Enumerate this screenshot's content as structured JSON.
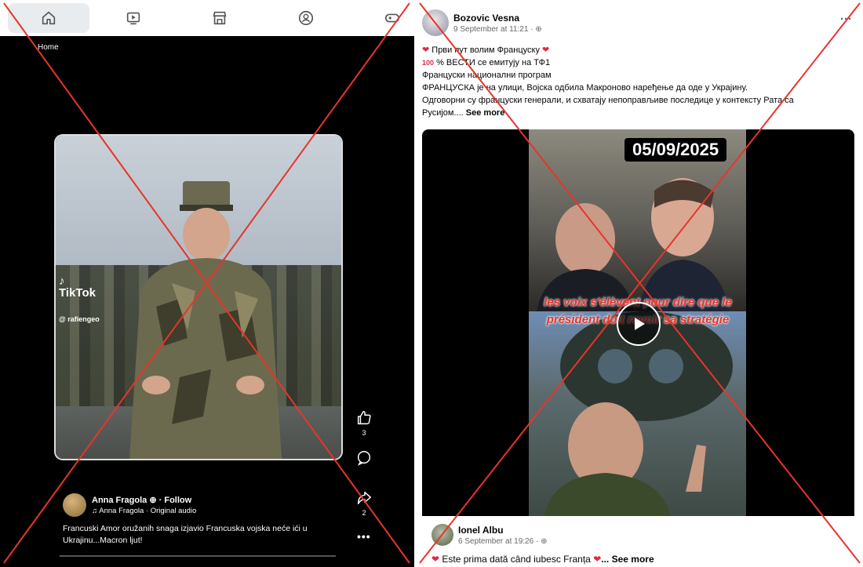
{
  "left": {
    "nav_tabs": [
      {
        "icon": "home-icon",
        "active": true
      },
      {
        "icon": "video-icon",
        "active": false
      },
      {
        "icon": "marketplace-icon",
        "active": false
      },
      {
        "icon": "groups-icon",
        "active": false
      },
      {
        "icon": "gaming-icon",
        "active": false
      }
    ],
    "breadcrumb": "Home",
    "tiktok_logo": "TikTok",
    "tiktok_user": "@ rafiengeo",
    "actions": {
      "likes": "3",
      "shares": "2"
    },
    "author": {
      "name": "Anna Fragola",
      "follow": "· Follow",
      "audio": "Anna Fragola · Original audio"
    },
    "caption": "Francuski Amor oružanih snaga izjavio Francuska vojska  neće ići u Ukrajinu...Macron ljut!"
  },
  "right": {
    "poster": {
      "name": "Bozovic Vesna",
      "time": "9 September at 11:21 · "
    },
    "post_lines": [
      "Први пут волим Француску",
      "% ВЕСТИ се емитују на ТФ1",
      "Француски национални програм",
      "ФРАНЦУСКА је на улици, Војска одбила Макроново наређење да оде у Украјину.",
      "Одговорни су француски генерали, и схватају непоправљиве последице у контексту Рата са",
      "Русијом...."
    ],
    "see_more": "See more",
    "video": {
      "date_badge": "05/09/2025",
      "overlay_text": "les voix s'élèvent pour dire que le président doit revoir sa stratégie"
    },
    "comment": {
      "name": "Ionel Albu",
      "time": "6 September at 19:26 · ",
      "text": "Este prima dată când iubesc Franța",
      "see_more": "... See more"
    }
  },
  "colors": {
    "cross": "#e8342b",
    "heart": "#e02b45"
  }
}
